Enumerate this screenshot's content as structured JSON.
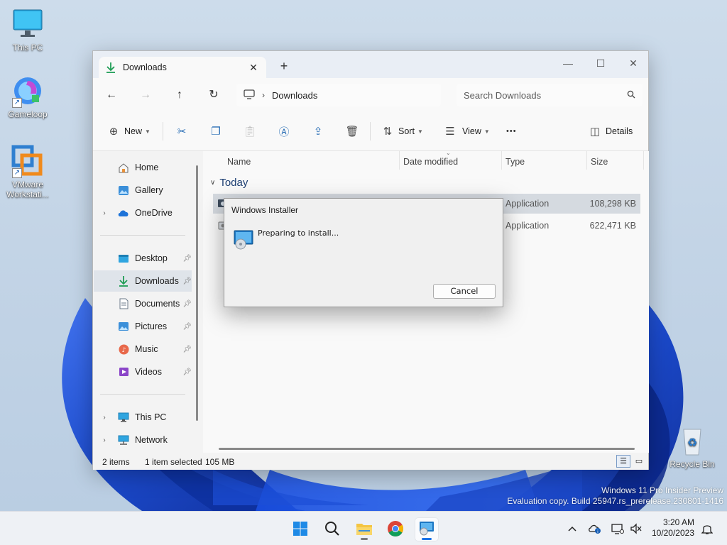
{
  "desktop": {
    "icons": [
      {
        "label": "This PC"
      },
      {
        "label": "Gameloop"
      },
      {
        "label": "VMware Workstati..."
      },
      {
        "label": "Recycle Bin"
      }
    ],
    "watermark": {
      "line1": "Windows 11 Pro Insider Preview",
      "line2": "Evaluation copy. Build 25947.rs_prerelease.230801-1416"
    }
  },
  "explorer": {
    "tab_title": "Downloads",
    "tab_close": "✕",
    "new_tab": "+",
    "window_controls": {
      "minimize": "—",
      "maximize": "☐",
      "close": "✕"
    },
    "breadcrumb": {
      "sep": "›",
      "location": "Downloads"
    },
    "search_placeholder": "Search Downloads",
    "commands": {
      "new": "New",
      "sort": "Sort",
      "view": "View",
      "more": "•••",
      "details": "Details"
    },
    "nav": {
      "home": "Home",
      "gallery": "Gallery",
      "onedrive": "OneDrive",
      "desktop": "Desktop",
      "downloads": "Downloads",
      "documents": "Documents",
      "pictures": "Pictures",
      "music": "Music",
      "videos": "Videos",
      "thispc": "This PC",
      "network": "Network"
    },
    "columns": {
      "name": "Name",
      "date_modified": "Date modified",
      "type": "Type",
      "size": "Size"
    },
    "group": "Today",
    "files": [
      {
        "type": "Application",
        "size": "108,298 KB",
        "selected": true
      },
      {
        "type": "Application",
        "size": "622,471 KB",
        "selected": false
      }
    ],
    "status": {
      "items": "2 items",
      "selected": "1 item selected",
      "selected_size": "105 MB"
    }
  },
  "installer": {
    "title": "Windows Installer",
    "message": "Preparing to install...",
    "cancel": "Cancel"
  },
  "taskbar": {
    "time": "3:20 AM",
    "date": "10/20/2023",
    "apps": [
      "start-icon",
      "search-icon",
      "file-explorer-icon",
      "chrome-icon",
      "installer-icon"
    ]
  }
}
